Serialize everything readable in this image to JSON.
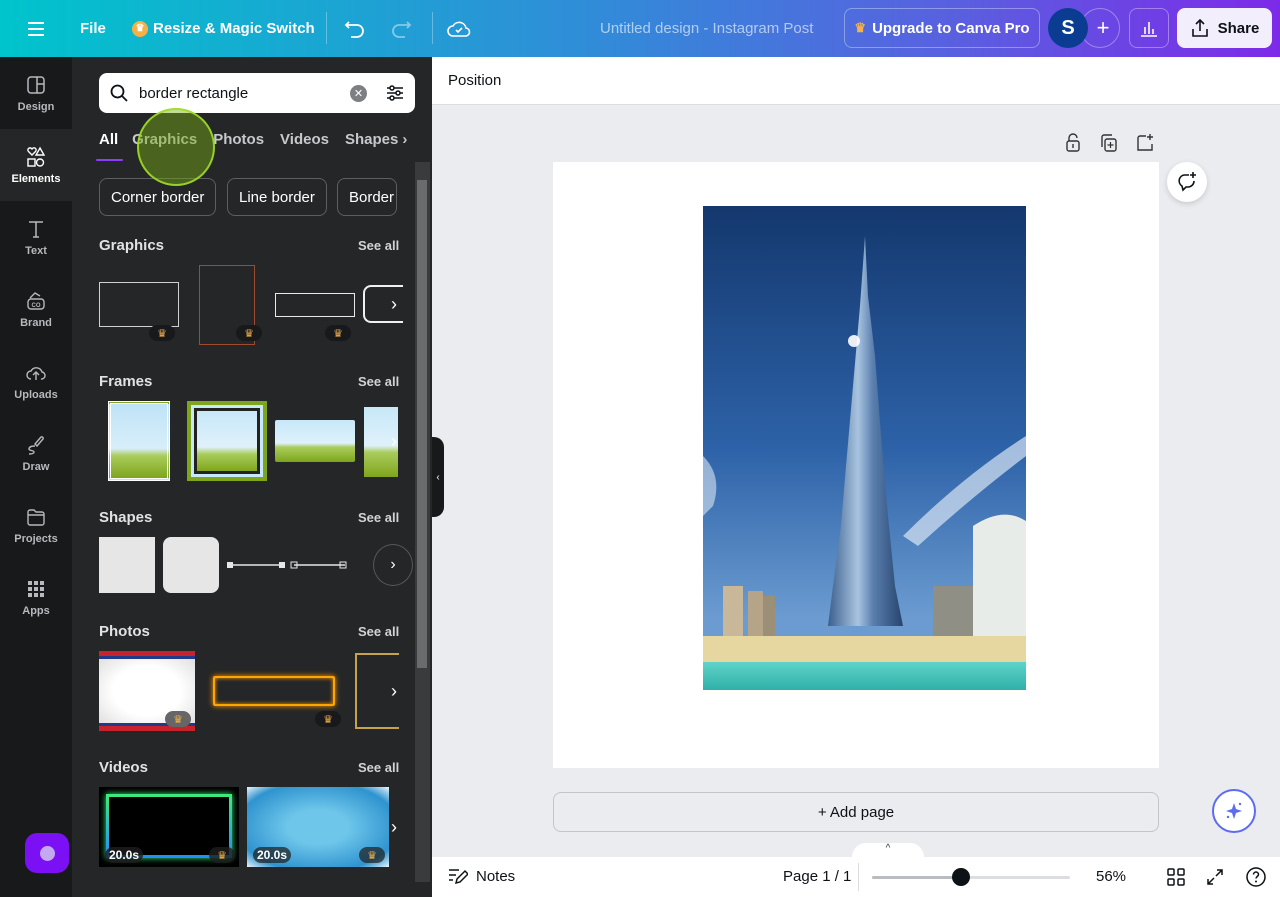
{
  "topbar": {
    "menu_icon": "hamburger-icon",
    "file_label": "File",
    "resize_label": "Resize & Magic Switch",
    "title": "Untitled design - Instagram Post",
    "upgrade_label": "Upgrade to Canva Pro",
    "avatar_initial": "S",
    "share_label": "Share"
  },
  "rail": {
    "items": [
      {
        "label": "Design",
        "icon": "layout-icon"
      },
      {
        "label": "Elements",
        "icon": "shapes-icon",
        "active": true
      },
      {
        "label": "Text",
        "icon": "text-icon"
      },
      {
        "label": "Brand",
        "icon": "brand-icon"
      },
      {
        "label": "Uploads",
        "icon": "upload-cloud-icon"
      },
      {
        "label": "Draw",
        "icon": "draw-icon"
      },
      {
        "label": "Projects",
        "icon": "folder-icon"
      },
      {
        "label": "Apps",
        "icon": "apps-grid-icon"
      }
    ]
  },
  "panel": {
    "search_value": "border rectangle",
    "tabs": [
      "All",
      "Graphics",
      "Photos",
      "Videos",
      "Shapes"
    ],
    "active_tab": "All",
    "chips": [
      "Corner border",
      "Line border",
      "Border"
    ],
    "sections": {
      "graphics": {
        "title": "Graphics",
        "see_all": "See all"
      },
      "frames": {
        "title": "Frames",
        "see_all": "See all"
      },
      "shapes": {
        "title": "Shapes",
        "see_all": "See all"
      },
      "photos": {
        "title": "Photos",
        "see_all": "See all"
      },
      "videos": {
        "title": "Videos",
        "see_all": "See all",
        "durations": [
          "20.0s",
          "20.0s"
        ]
      }
    }
  },
  "canvas": {
    "context_label": "Position",
    "add_page_label": "+ Add page"
  },
  "footer": {
    "notes_label": "Notes",
    "page_indicator": "Page 1 / 1",
    "zoom_label": "56%",
    "zoom_fraction": 0.45
  },
  "colors": {
    "accent": "#8b3dff",
    "premium": "#f7b046"
  }
}
